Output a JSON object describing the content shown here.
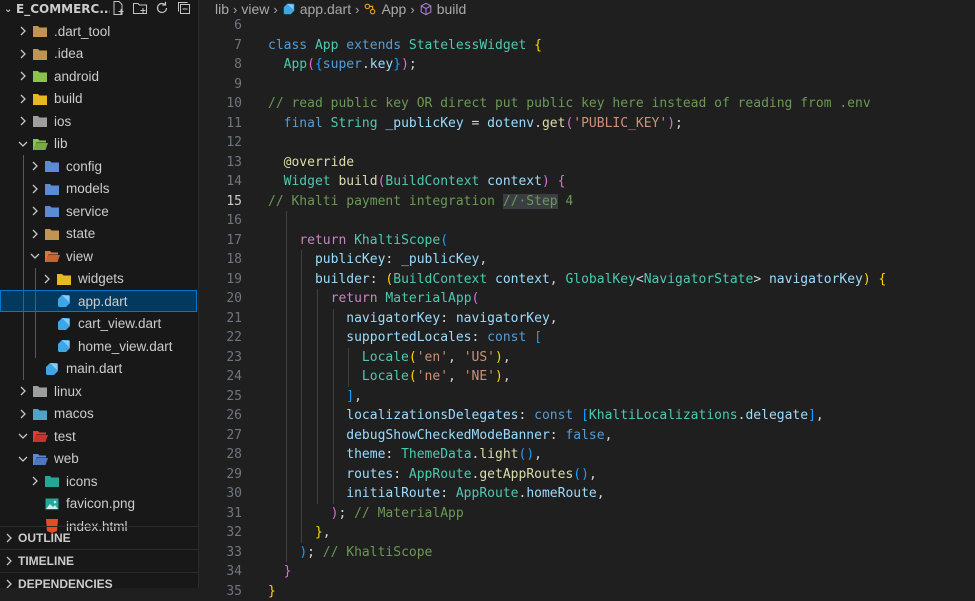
{
  "explorer": {
    "project_name": "E_COMMERC...",
    "items": [
      {
        "label": ".dart_tool",
        "depth": 0,
        "expanded": false,
        "icon": "folder-dart-icon"
      },
      {
        "label": ".idea",
        "depth": 0,
        "expanded": false,
        "icon": "folder-idea-icon"
      },
      {
        "label": "android",
        "depth": 0,
        "expanded": false,
        "icon": "folder-android-icon"
      },
      {
        "label": "build",
        "depth": 0,
        "expanded": false,
        "icon": "folder-build-icon"
      },
      {
        "label": "ios",
        "depth": 0,
        "expanded": false,
        "icon": "folder-ios-icon"
      },
      {
        "label": "lib",
        "depth": 0,
        "expanded": true,
        "icon": "folder-lib-open-icon"
      },
      {
        "label": "config",
        "depth": 1,
        "expanded": false,
        "icon": "folder-config-icon"
      },
      {
        "label": "models",
        "depth": 1,
        "expanded": false,
        "icon": "folder-models-icon"
      },
      {
        "label": "service",
        "depth": 1,
        "expanded": false,
        "icon": "folder-service-icon"
      },
      {
        "label": "state",
        "depth": 1,
        "expanded": false,
        "icon": "folder-state-icon"
      },
      {
        "label": "view",
        "depth": 1,
        "expanded": true,
        "icon": "folder-view-open-icon"
      },
      {
        "label": "widgets",
        "depth": 2,
        "expanded": false,
        "icon": "folder-widgets-icon"
      },
      {
        "label": "app.dart",
        "depth": 2,
        "file": true,
        "active": true,
        "icon": "dart-file-icon"
      },
      {
        "label": "cart_view.dart",
        "depth": 2,
        "file": true,
        "icon": "dart-file-icon"
      },
      {
        "label": "home_view.dart",
        "depth": 2,
        "file": true,
        "icon": "dart-file-icon"
      },
      {
        "label": "main.dart",
        "depth": 1,
        "file": true,
        "icon": "dart-file-icon"
      },
      {
        "label": "linux",
        "depth": 0,
        "expanded": false,
        "icon": "folder-linux-icon"
      },
      {
        "label": "macos",
        "depth": 0,
        "expanded": false,
        "icon": "folder-macos-icon"
      },
      {
        "label": "test",
        "depth": 0,
        "expanded": true,
        "icon": "folder-test-open-icon"
      },
      {
        "label": "web",
        "depth": 0,
        "expanded": true,
        "icon": "folder-web-open-icon"
      },
      {
        "label": "icons",
        "depth": 1,
        "expanded": false,
        "icon": "folder-icons-icon"
      },
      {
        "label": "favicon.png",
        "depth": 1,
        "file": true,
        "icon": "image-file-icon"
      },
      {
        "label": "index.html",
        "depth": 1,
        "file": true,
        "icon": "html-file-icon"
      }
    ]
  },
  "panels": {
    "outline": "OUTLINE",
    "timeline": "TIMELINE",
    "dependencies": "DEPENDENCIES"
  },
  "breadcrumb": {
    "seg1": "lib",
    "seg2": "view",
    "seg3": "app.dart",
    "seg4": "App",
    "seg5": "build"
  },
  "editor": {
    "current_line": 15,
    "lines": [
      {
        "n": 6,
        "t": []
      },
      {
        "n": 7,
        "t": [
          [
            "class ",
            "kw"
          ],
          [
            "App ",
            "ty"
          ],
          [
            "extends ",
            "kw"
          ],
          [
            "StatelessWidget ",
            "ty"
          ],
          [
            "{",
            "b1"
          ]
        ]
      },
      {
        "n": 8,
        "t": [
          [
            "  "
          ],
          [
            "App",
            "ty"
          ],
          [
            "(",
            "b2"
          ],
          [
            "{",
            "b3"
          ],
          [
            "super",
            "kw"
          ],
          [
            ".",
            "pu"
          ],
          [
            "key",
            "va"
          ],
          [
            "}",
            "b3"
          ],
          [
            ")",
            "b2"
          ],
          [
            ";",
            "pu"
          ]
        ]
      },
      {
        "n": 9,
        "t": []
      },
      {
        "n": 10,
        "t": [
          [
            "// read public key OR direct put public key here instead of reading from .env",
            "cm"
          ]
        ]
      },
      {
        "n": 11,
        "t": [
          [
            "  "
          ],
          [
            "final ",
            "kw"
          ],
          [
            "String ",
            "ty"
          ],
          [
            "_publicKey ",
            "va"
          ],
          [
            "= ",
            "pu"
          ],
          [
            "dotenv",
            "va"
          ],
          [
            ".",
            "pu"
          ],
          [
            "get",
            "fn"
          ],
          [
            "(",
            "b2"
          ],
          [
            "'PUBLIC_KEY'",
            "st"
          ],
          [
            ")",
            "b2"
          ],
          [
            ";",
            "pu"
          ]
        ]
      },
      {
        "n": 12,
        "t": []
      },
      {
        "n": 13,
        "t": [
          [
            "  "
          ],
          [
            "@override",
            "fn"
          ]
        ]
      },
      {
        "n": 14,
        "t": [
          [
            "  "
          ],
          [
            "Widget ",
            "ty"
          ],
          [
            "build",
            "fn"
          ],
          [
            "(",
            "b2"
          ],
          [
            "BuildContext ",
            "ty"
          ],
          [
            "context",
            "va"
          ],
          [
            ") ",
            "b2"
          ],
          [
            "{",
            "b2"
          ]
        ]
      },
      {
        "n": 15,
        "t": [
          [
            "// Khalti payment integration ",
            "cm"
          ],
          [
            "//·",
            "cm hl"
          ],
          [
            "Step",
            "cm hl"
          ],
          [
            " 4",
            "cm"
          ]
        ]
      },
      {
        "n": 16,
        "t": []
      },
      {
        "n": 17,
        "t": [
          [
            "    "
          ],
          [
            "return ",
            "ctl"
          ],
          [
            "KhaltiScope",
            "ty"
          ],
          [
            "(",
            "b3"
          ]
        ]
      },
      {
        "n": 18,
        "t": [
          [
            "      "
          ],
          [
            "publicKey",
            "va"
          ],
          [
            ": ",
            "pu"
          ],
          [
            "_publicKey",
            "va"
          ],
          [
            ",",
            "pu"
          ]
        ]
      },
      {
        "n": 19,
        "t": [
          [
            "      "
          ],
          [
            "builder",
            "va"
          ],
          [
            ": ",
            "pu"
          ],
          [
            "(",
            "b1"
          ],
          [
            "BuildContext ",
            "ty"
          ],
          [
            "context",
            "va"
          ],
          [
            ", ",
            "pu"
          ],
          [
            "GlobalKey",
            "ty"
          ],
          [
            "<",
            "pu"
          ],
          [
            "NavigatorState",
            "ty"
          ],
          [
            "> ",
            "pu"
          ],
          [
            "navigatorKey",
            "va"
          ],
          [
            ") ",
            "b1"
          ],
          [
            "{",
            "b1"
          ]
        ]
      },
      {
        "n": 20,
        "t": [
          [
            "        "
          ],
          [
            "return ",
            "ctl"
          ],
          [
            "MaterialApp",
            "ty"
          ],
          [
            "(",
            "b2"
          ]
        ]
      },
      {
        "n": 21,
        "t": [
          [
            "          "
          ],
          [
            "navigatorKey",
            "va"
          ],
          [
            ": ",
            "pu"
          ],
          [
            "navigatorKey",
            "va"
          ],
          [
            ",",
            "pu"
          ]
        ]
      },
      {
        "n": 22,
        "t": [
          [
            "          "
          ],
          [
            "supportedLocales",
            "va"
          ],
          [
            ": ",
            "pu"
          ],
          [
            "const ",
            "kw"
          ],
          [
            "[",
            "b3"
          ]
        ]
      },
      {
        "n": 23,
        "t": [
          [
            "            "
          ],
          [
            "Locale",
            "ty"
          ],
          [
            "(",
            "b1"
          ],
          [
            "'en'",
            "st"
          ],
          [
            ", ",
            "pu"
          ],
          [
            "'US'",
            "st"
          ],
          [
            ")",
            "b1"
          ],
          [
            ",",
            "pu"
          ]
        ]
      },
      {
        "n": 24,
        "t": [
          [
            "            "
          ],
          [
            "Locale",
            "ty"
          ],
          [
            "(",
            "b1"
          ],
          [
            "'ne'",
            "st"
          ],
          [
            ", ",
            "pu"
          ],
          [
            "'NE'",
            "st"
          ],
          [
            ")",
            "b1"
          ],
          [
            ",",
            "pu"
          ]
        ]
      },
      {
        "n": 25,
        "t": [
          [
            "          "
          ],
          [
            "]",
            "b3"
          ],
          [
            ",",
            "pu"
          ]
        ]
      },
      {
        "n": 26,
        "t": [
          [
            "          "
          ],
          [
            "localizationsDelegates",
            "va"
          ],
          [
            ": ",
            "pu"
          ],
          [
            "const ",
            "kw"
          ],
          [
            "[",
            "b3"
          ],
          [
            "KhaltiLocalizations",
            "ty"
          ],
          [
            ".",
            "pu"
          ],
          [
            "delegate",
            "va"
          ],
          [
            "]",
            "b3"
          ],
          [
            ",",
            "pu"
          ]
        ]
      },
      {
        "n": 27,
        "t": [
          [
            "          "
          ],
          [
            "debugShowCheckedModeBanner",
            "va"
          ],
          [
            ": ",
            "pu"
          ],
          [
            "false",
            "kw"
          ],
          [
            ",",
            "pu"
          ]
        ]
      },
      {
        "n": 28,
        "t": [
          [
            "          "
          ],
          [
            "theme",
            "va"
          ],
          [
            ": ",
            "pu"
          ],
          [
            "ThemeData",
            "ty"
          ],
          [
            ".",
            "pu"
          ],
          [
            "light",
            "fn"
          ],
          [
            "(",
            "b3"
          ],
          [
            ")",
            "b3"
          ],
          [
            ",",
            "pu"
          ]
        ]
      },
      {
        "n": 29,
        "t": [
          [
            "          "
          ],
          [
            "routes",
            "va"
          ],
          [
            ": ",
            "pu"
          ],
          [
            "AppRoute",
            "ty"
          ],
          [
            ".",
            "pu"
          ],
          [
            "getAppRoutes",
            "fn"
          ],
          [
            "(",
            "b3"
          ],
          [
            ")",
            "b3"
          ],
          [
            ",",
            "pu"
          ]
        ]
      },
      {
        "n": 30,
        "t": [
          [
            "          "
          ],
          [
            "initialRoute",
            "va"
          ],
          [
            ": ",
            "pu"
          ],
          [
            "AppRoute",
            "ty"
          ],
          [
            ".",
            "pu"
          ],
          [
            "homeRoute",
            "va"
          ],
          [
            ",",
            "pu"
          ]
        ]
      },
      {
        "n": 31,
        "t": [
          [
            "        "
          ],
          [
            ")",
            "b2"
          ],
          [
            "; ",
            "pu"
          ],
          [
            "// MaterialApp",
            "cm"
          ]
        ]
      },
      {
        "n": 32,
        "t": [
          [
            "      "
          ],
          [
            "}",
            "b1"
          ],
          [
            ",",
            "pu"
          ]
        ]
      },
      {
        "n": 33,
        "t": [
          [
            "    "
          ],
          [
            ")",
            "b3"
          ],
          [
            "; ",
            "pu"
          ],
          [
            "// KhaltiScope",
            "cm"
          ]
        ]
      },
      {
        "n": 34,
        "t": [
          [
            "  "
          ],
          [
            "}",
            "b2"
          ]
        ]
      },
      {
        "n": 35,
        "t": [
          [
            "}",
            "b1"
          ]
        ]
      }
    ]
  },
  "colors": {
    "editor_bg": "#1f1f1f",
    "sidebar_bg": "#181818",
    "active_row": "#04395e",
    "focus_border": "#0078d4"
  }
}
